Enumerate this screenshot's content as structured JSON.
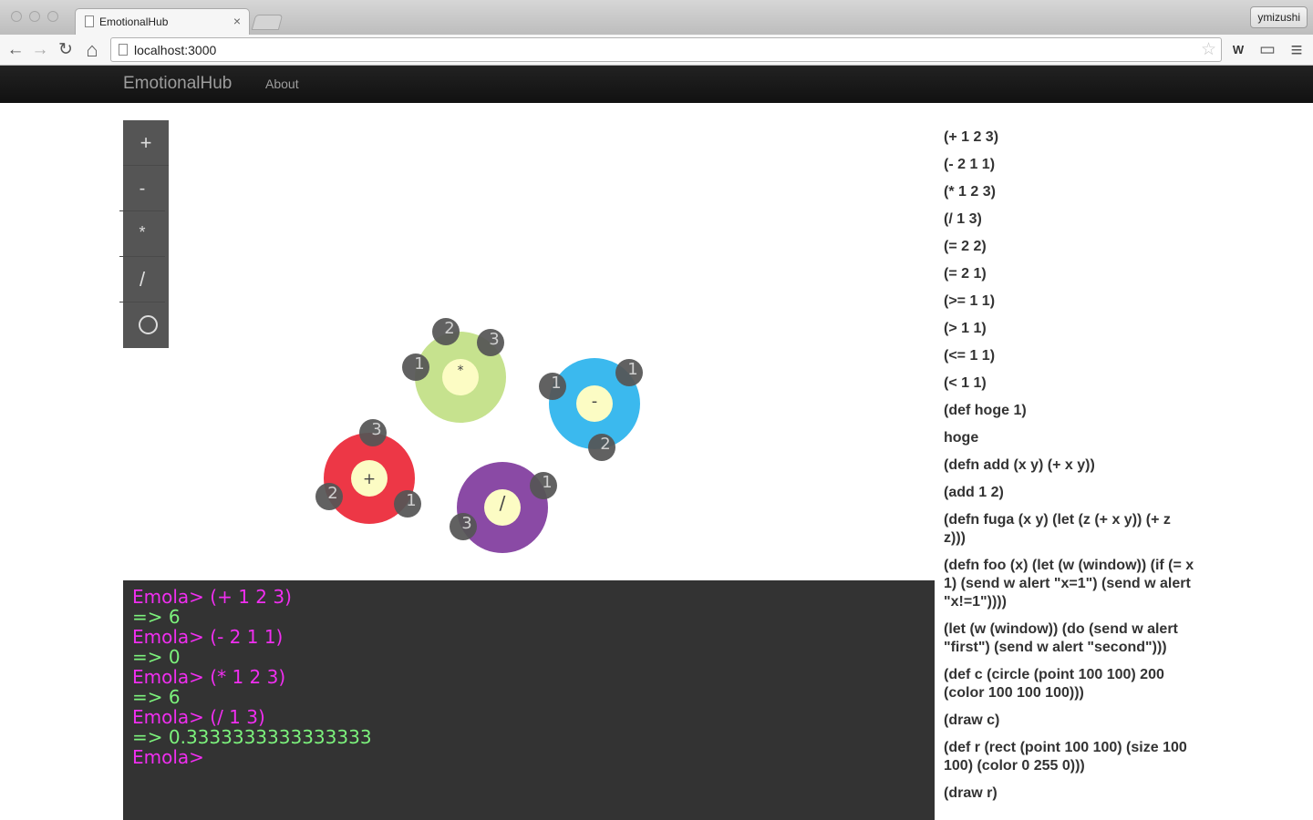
{
  "browser": {
    "tab_title": "EmotionalHub",
    "tab_close": "×",
    "url": "localhost:3000",
    "user": "ymizushi",
    "back_icon": "←",
    "forward_icon": "→",
    "reload_icon": "↻",
    "home_icon": "⌂",
    "star_icon": "☆",
    "ext_label": "W",
    "cast_icon": "▭",
    "menu_icon": "≡"
  },
  "nav": {
    "brand": "EmotionalHub",
    "about": "About"
  },
  "palette": {
    "items": [
      "+",
      "-",
      "*",
      "/"
    ]
  },
  "canvas": {
    "nodes": [
      {
        "op": "*",
        "color": "#c6e28e",
        "args": [
          "1",
          "2",
          "3"
        ]
      },
      {
        "op": "-",
        "color": "#3bb9ee",
        "args": [
          "1",
          "1",
          "2"
        ]
      },
      {
        "op": "+",
        "color": "#ed3746",
        "args": [
          "3",
          "2",
          "1"
        ]
      },
      {
        "op": "/",
        "color": "#8a4aa5",
        "args": [
          "1",
          "3"
        ]
      }
    ],
    "arg_color": "#555555",
    "center_color": "#fcfcc4"
  },
  "repl": {
    "lines": [
      {
        "kind": "prompt",
        "text": "Emola> (+ 1 2 3)"
      },
      {
        "kind": "result",
        "text": "=> 6"
      },
      {
        "kind": "prompt",
        "text": "Emola> (- 2 1 1)"
      },
      {
        "kind": "result",
        "text": "=> 0"
      },
      {
        "kind": "prompt",
        "text": "Emola> (* 1 2 3)"
      },
      {
        "kind": "result",
        "text": "=> 6"
      },
      {
        "kind": "prompt",
        "text": "Emola> (/ 1 3)"
      },
      {
        "kind": "result",
        "text": "=> 0.3333333333333333"
      },
      {
        "kind": "prompt",
        "text": "Emola>"
      }
    ]
  },
  "history": [
    "(+ 1 2 3)",
    "(- 2 1 1)",
    "(* 1 2 3)",
    "(/ 1 3)",
    "(= 2 2)",
    "(= 2 1)",
    "(>= 1 1)",
    "(> 1 1)",
    "(<= 1 1)",
    "(< 1 1)",
    "(def hoge 1)",
    "hoge",
    "(defn add (x y) (+ x y))",
    "(add 1 2)",
    "(defn fuga (x y) (let (z (+ x y)) (+ z z)))",
    "(defn foo (x) (let (w (window)) (if (= x 1) (send w alert \"x=1\") (send w alert \"x!=1\"))))",
    "(let (w (window)) (do (send w alert \"first\") (send w alert \"second\")))",
    "(def c (circle (point 100 100) 200 (color 100 100 100)))",
    "(draw c)",
    "(def r (rect (point 100 100) (size 100 100) (color 0 255 0)))",
    "(draw r)"
  ]
}
